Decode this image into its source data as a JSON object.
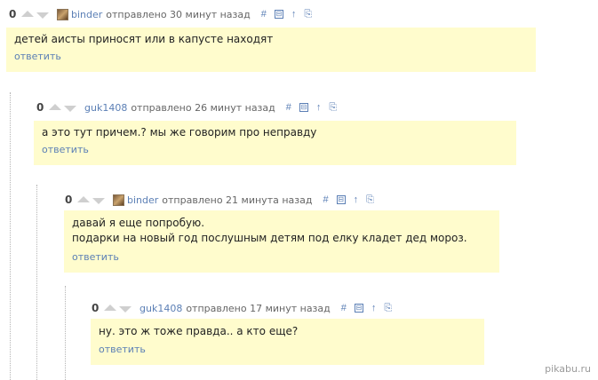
{
  "comments": [
    {
      "score": "0",
      "author": "binder",
      "meta": "отправлено 30 минут назад",
      "has_avatar": true,
      "lines": [
        "детей аисты приносят или в капусте находят"
      ],
      "reply": "ответить"
    },
    {
      "score": "0",
      "author": "guk1408",
      "meta": "отправлено 26 минут назад",
      "has_avatar": false,
      "lines": [
        "а это тут причем.? мы же говорим про неправду"
      ],
      "reply": "ответить"
    },
    {
      "score": "0",
      "author": "binder",
      "meta": "отправлено 21 минута назад",
      "has_avatar": true,
      "lines": [
        "давай я еще попробую.",
        "подарки на новый год послушным детям под елку кладет дед мороз."
      ],
      "reply": "ответить"
    },
    {
      "score": "0",
      "author": "guk1408",
      "meta": "отправлено 17 минут назад",
      "has_avatar": false,
      "lines": [
        "ну. это ж тоже правда.. а кто еще?"
      ],
      "reply": "ответить"
    }
  ],
  "tools": {
    "link": "#",
    "collapse": "⊟",
    "parent": "↑",
    "save": "⎘"
  },
  "icons": {
    "upvote": "upvote-arrow-icon",
    "downvote": "downvote-arrow-icon",
    "avatar": "user-avatar-icon"
  },
  "watermark": "pikabu.ru"
}
